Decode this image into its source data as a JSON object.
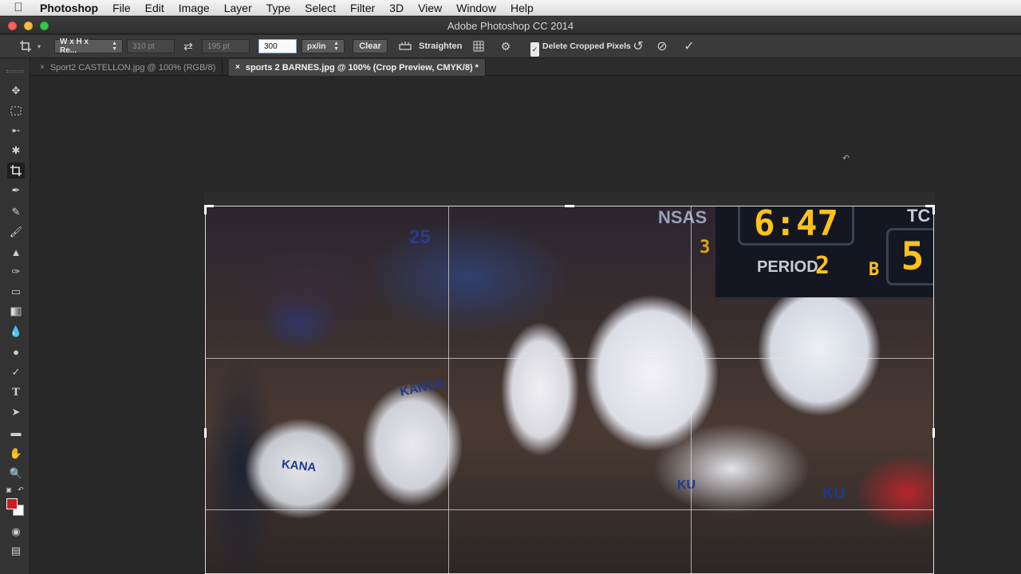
{
  "menubar": {
    "apple": "",
    "app": "Photoshop",
    "items": [
      "File",
      "Edit",
      "Image",
      "Layer",
      "Type",
      "Select",
      "Filter",
      "3D",
      "View",
      "Window",
      "Help"
    ]
  },
  "window": {
    "title": "Adobe Photoshop CC 2014"
  },
  "options": {
    "preset": "W x H x Re...",
    "width_value": "310 pt",
    "swap_icon": "swap-icon",
    "height_value": "195 pt",
    "resolution_value": "300",
    "resolution_unit": "px/in",
    "clear_label": "Clear",
    "straighten_label": "Straighten",
    "delete_cropped_label": "Delete Cropped Pixels",
    "delete_cropped_checked": true
  },
  "tabs": [
    {
      "label": "Sport2 CASTELLON.jpg @ 100% (RGB/8)",
      "active": false
    },
    {
      "label": "sports 2 BARNES.jpg @ 100% (Crop Preview, CMYK/8) *",
      "active": true
    }
  ],
  "tools": [
    "move",
    "marquee",
    "lasso",
    "quick-select",
    "crop",
    "eyedropper",
    "healing",
    "brush",
    "clone-stamp",
    "history-brush",
    "eraser",
    "gradient",
    "blur",
    "dodge",
    "pen",
    "type",
    "path-select",
    "shape",
    "hand",
    "zoom"
  ],
  "colors": {
    "foreground": "#d01a20",
    "background": "#ffffff"
  },
  "scoreboard": {
    "clock": "6:47",
    "period_label": "PERIOD",
    "period_value": "2",
    "team_left_digit": "3",
    "team_right_letter": "B",
    "team_right_score": "5",
    "top_left_text": "NSAS",
    "top_right_text": "TC"
  },
  "photo": {
    "jersey_numbers": [
      "25"
    ],
    "jersey_text": [
      "KANSA",
      "KANA",
      "KU",
      "KU"
    ]
  }
}
